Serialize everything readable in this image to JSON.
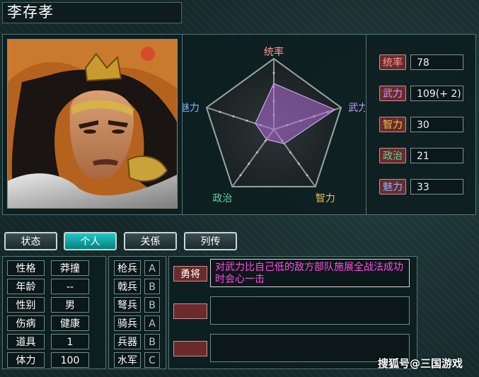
{
  "general": {
    "name": "李存孝"
  },
  "radar": {
    "axes": [
      "统率",
      "武力",
      "智力",
      "政治",
      "魅力"
    ],
    "axis_colors": [
      "#ff9a9a",
      "#c69bff",
      "#e8c14a",
      "#5fd29a",
      "#7fb6ff"
    ],
    "values": [
      78,
      109,
      30,
      21,
      33
    ],
    "max": 120
  },
  "stats": [
    {
      "label": "统率",
      "value": "78",
      "color": "#ff9a9a"
    },
    {
      "label": "武力",
      "value": "109(+ 2)",
      "color": "#c69bff"
    },
    {
      "label": "智力",
      "value": "30",
      "color": "#e8c14a"
    },
    {
      "label": "政治",
      "value": "21",
      "color": "#5fd29a"
    },
    {
      "label": "魅力",
      "value": "33",
      "color": "#7fb6ff"
    }
  ],
  "tabs": [
    {
      "label": "状态"
    },
    {
      "label": "个人",
      "active": true
    },
    {
      "label": "关係"
    },
    {
      "label": "列传"
    }
  ],
  "personal": [
    {
      "label": "性格",
      "value": "莽撞"
    },
    {
      "label": "年龄",
      "value": "--"
    },
    {
      "label": "性别",
      "value": "男"
    },
    {
      "label": "伤病",
      "value": "健康"
    },
    {
      "label": "道具",
      "value": "1"
    },
    {
      "label": "体力",
      "value": "100"
    }
  ],
  "aptitudes": [
    {
      "label": "枪兵",
      "grade": "A"
    },
    {
      "label": "戟兵",
      "grade": "B"
    },
    {
      "label": "弩兵",
      "grade": "B"
    },
    {
      "label": "骑兵",
      "grade": "A"
    },
    {
      "label": "兵器",
      "grade": "B"
    },
    {
      "label": "水军",
      "grade": "C"
    }
  ],
  "skills": [
    {
      "name": "勇将",
      "description": "对武力比自己低的敌方部队施展全战法成功时会心一击"
    },
    {
      "name": "",
      "description": ""
    },
    {
      "name": "",
      "description": ""
    }
  ],
  "watermark": "搜狐号@三国游戏"
}
